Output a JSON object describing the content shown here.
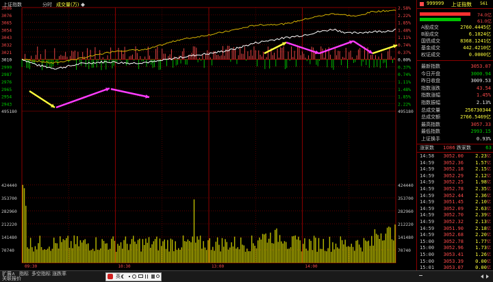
{
  "header": {
    "index_name": "上证指数",
    "mode": "分时",
    "volume_label": "成交量(万)",
    "pin_icon": "diamond-icon"
  },
  "price_axis": {
    "left": [
      "3086",
      "3076",
      "3065",
      "3054",
      "3043",
      "3032",
      "3021",
      "3010",
      "2999",
      "2987",
      "2976",
      "2965",
      "2954",
      "2943",
      "495180"
    ],
    "right": [
      "2.58%",
      "2.22%",
      "1.85%",
      "1.48%",
      "1.11%",
      "0.74%",
      "0.37%",
      "0.00%",
      "0.37%",
      "0.74%",
      "1.11%",
      "1.48%",
      "1.85%",
      "2.22%",
      "495180"
    ]
  },
  "volume_axis": {
    "left": [
      "424440",
      "353700",
      "282960",
      "212220",
      "141480",
      "70740"
    ],
    "right": [
      "424440",
      "353700",
      "282960",
      "212220",
      "141480",
      "70740"
    ]
  },
  "time_axis": [
    "09:30",
    "10:30",
    "13:00",
    "14:00"
  ],
  "quote_header": {
    "code": "999999",
    "name": "上证指数",
    "suffix": "561",
    "bar_red_value": "74.0亿",
    "bar_green_value": "61.0亿"
  },
  "turnover": [
    {
      "label": "A股成交",
      "value": "2760.4445亿"
    },
    {
      "label": "B股成交",
      "value": "6.1024亿"
    },
    {
      "label": "国债成交",
      "value": "8368.1241亿"
    },
    {
      "label": "基金成交",
      "value": "442.4210亿"
    },
    {
      "label": "权证成交",
      "value": "0.0000亿"
    }
  ],
  "stats": [
    {
      "label": "最新指数",
      "value": "3053.07",
      "color": "#ff4b4b"
    },
    {
      "label": "今日开盘",
      "value": "3000.94",
      "color": "#00d000"
    },
    {
      "label": "昨日收盘",
      "value": "3009.53",
      "color": "#e8e8e8"
    },
    {
      "label": "指数涨跌",
      "value": "43.54",
      "color": "#ff4b4b"
    },
    {
      "label": "指数涨幅",
      "value": "1.45%",
      "color": "#ff4b4b"
    },
    {
      "label": "指数振幅",
      "value": "2.13%",
      "color": "#e8e8e8"
    },
    {
      "label": "总成交量",
      "value": "256730344",
      "color": "#ffff3c"
    },
    {
      "label": "总成交额",
      "value": "2766.5469亿",
      "color": "#ffff3c"
    },
    {
      "label": "最高指数",
      "value": "3057.33",
      "color": "#ff4b4b"
    },
    {
      "label": "最低指数",
      "value": "2993.15",
      "color": "#00d000"
    },
    {
      "label": "上证换手",
      "value": "0.93%",
      "color": "#e8e8e8"
    }
  ],
  "breadth": {
    "up_label": "涨家数",
    "up_count": "1086",
    "down_label": "跌家数",
    "down_count": "63"
  },
  "trades": [
    {
      "time": "14:58",
      "price": "3052.00",
      "vol": "2.23"
    },
    {
      "time": "14:59",
      "price": "3052.36",
      "vol": "1.57"
    },
    {
      "time": "14:59",
      "price": "3052.18",
      "vol": "2.15"
    },
    {
      "time": "14:59",
      "price": "3052.29",
      "vol": "2.12"
    },
    {
      "time": "14:59",
      "price": "3052.25",
      "vol": "1.98"
    },
    {
      "time": "14:59",
      "price": "3052.78",
      "vol": "2.35"
    },
    {
      "time": "14:59",
      "price": "3052.44",
      "vol": "2.36"
    },
    {
      "time": "14:59",
      "price": "3051.45",
      "vol": "2.10"
    },
    {
      "time": "14:59",
      "price": "3052.09",
      "vol": "2.63"
    },
    {
      "time": "14:59",
      "price": "3052.70",
      "vol": "2.39"
    },
    {
      "time": "14:59",
      "price": "3052.32",
      "vol": "2.13"
    },
    {
      "time": "14:59",
      "price": "3051.90",
      "vol": "2.18"
    },
    {
      "time": "14:59",
      "price": "3052.68",
      "vol": "2.20"
    },
    {
      "time": "15:00",
      "price": "3052.78",
      "vol": "1.77"
    },
    {
      "time": "15:00",
      "price": "3052.96",
      "vol": "1.73"
    },
    {
      "time": "15:00",
      "price": "3053.41",
      "vol": "1.26"
    },
    {
      "time": "15:00",
      "price": "3053.39",
      "vol": "0.00"
    },
    {
      "time": "15:01",
      "price": "3053.07",
      "vol": "0.00"
    }
  ],
  "bottom_tabs": [
    "扩展∧",
    "指标",
    "多空指标",
    "涨跌率",
    "关联报价"
  ],
  "ime": {
    "lang": "英",
    "icons": [
      "moon-icon",
      "dot-icon",
      "emoji-icon",
      "keyboard-icon",
      "grid-icon",
      "shirt-icon",
      "settings-icon"
    ]
  },
  "colors": {
    "up": "#ff4b4b",
    "down": "#00d000",
    "grid": "#8b0000",
    "price_line": "#ffffff",
    "avg_line": "#d4b400",
    "arrow_yellow": "#ffff3c",
    "arrow_magenta": "#ff3cff"
  }
}
